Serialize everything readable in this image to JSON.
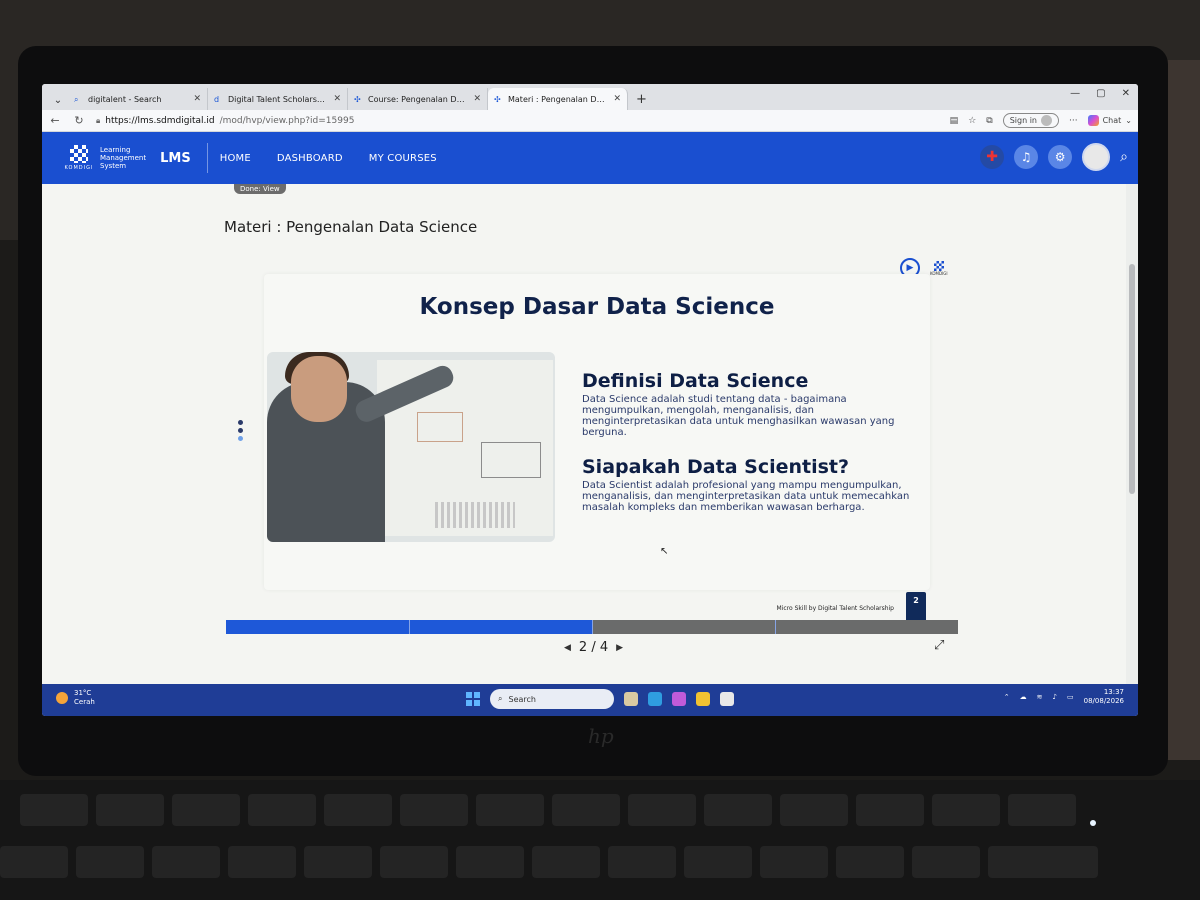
{
  "browser": {
    "tabs": [
      {
        "title": "digitalent - Search",
        "active": false
      },
      {
        "title": "Digital Talent Scholarship",
        "active": false
      },
      {
        "title": "Course: Pengenalan Data Science",
        "active": false
      },
      {
        "title": "Materi : Pengenalan Data Science",
        "active": true
      }
    ],
    "url_host": "https://lms.sdmdigital.id",
    "url_path": "/mod/hvp/view.php?id=15995",
    "signin_label": "Sign in",
    "chat_label": "Chat",
    "new_tab_symbol": "+"
  },
  "lms": {
    "brand_org": "KOMDIGI",
    "brand_line1": "Learning",
    "brand_line2": "Management",
    "brand_line3": "System",
    "brand_lms": "LMS",
    "menu": [
      "HOME",
      "DASHBOARD",
      "MY COURSES"
    ]
  },
  "page": {
    "done_chip": "Done: View",
    "title": "Materi : Pengenalan Data Science"
  },
  "slide": {
    "title": "Konsep Dasar Data Science",
    "logo_text": "KOMDIGI",
    "h1": "Definisi Data Science",
    "p1": "Data Science adalah studi tentang data - bagaimana mengumpulkan, mengolah, menganalisis, dan menginterpretasikan data untuk menghasilkan wawasan yang berguna.",
    "h2": "Siapakah Data Scientist?",
    "p2": "Data Scientist adalah profesional yang mampu mengumpulkan, menganalisis, dan menginterpretasikan data untuk memecahkan masalah kompleks dan memberikan wawasan berharga.",
    "footer": "Micro Skill by Digital Talent Scholarship",
    "page_badge": "2"
  },
  "player": {
    "current": 2,
    "total": 4,
    "pager_text": "2 / 4",
    "progress_fraction": 0.5
  },
  "taskbar": {
    "temp": "31°C",
    "weather": "Cerah",
    "search_label": "Search",
    "time": "13:37",
    "date": "08/08/2026"
  },
  "colors": {
    "lms_blue": "#1a4fd0",
    "slide_navy": "#10224a",
    "progress_gray": "#6a6b6b"
  }
}
